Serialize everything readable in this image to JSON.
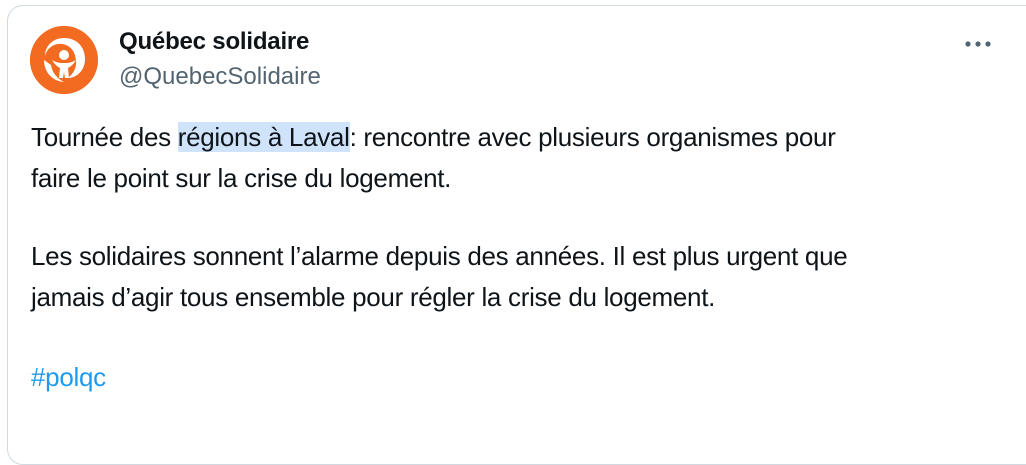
{
  "author": {
    "display_name": "Québec solidaire",
    "handle": "@QuebecSolidaire",
    "avatar_color": "#f26b21"
  },
  "more_options": {
    "icon": "more-horizontal-icon"
  },
  "tweet": {
    "paragraph1": {
      "line1_before": "Tournée des ",
      "line1_highlight": "régions à Laval",
      "line1_after": ": rencontre avec plusieurs organismes pour",
      "line2": "faire le point sur la crise du logement."
    },
    "paragraph2": {
      "line1": "Les solidaires sonnent l’alarme depuis des années. Il est plus urgent que",
      "line2": "jamais d’agir tous ensemble pour régler la crise du logement."
    },
    "hashtag": "#polqc"
  },
  "colors": {
    "hashtag": "#1d9bf0",
    "selection": "#cfe3fb",
    "secondary_text": "#536471",
    "border": "#cfd9de"
  }
}
